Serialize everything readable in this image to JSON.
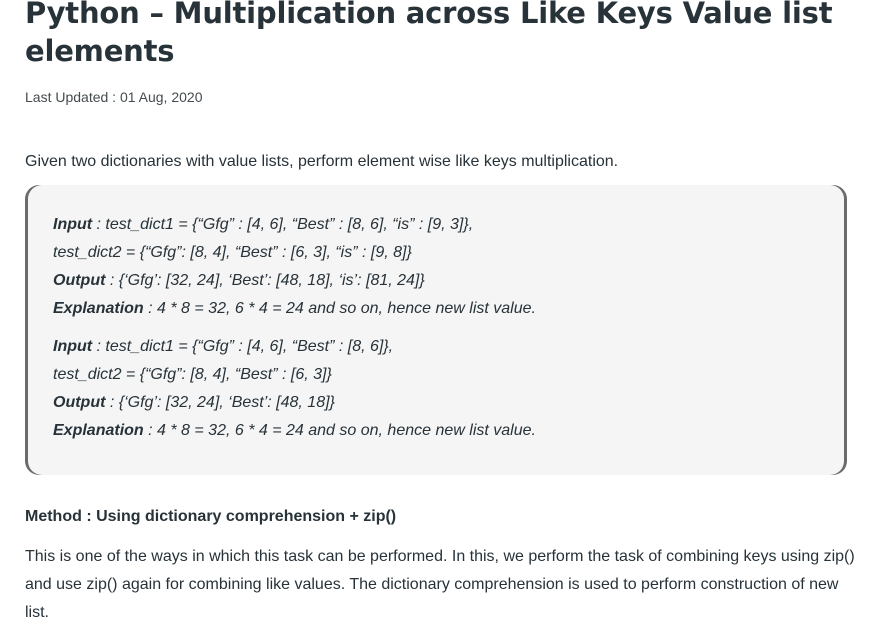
{
  "article": {
    "title": "Python – Multiplication across Like Keys Value list elements",
    "last_updated": "Last Updated : 01 Aug, 2020",
    "intro": "Given two dictionaries with value lists, perform element wise like keys multiplication.",
    "examples": [
      {
        "input_label": "Input",
        "input_value": " : test_dict1 = {“Gfg” : [4, 6], “Best” : [8, 6], “is” : [9, 3]},",
        "input_cont": "test_dict2 = {“Gfg”: [8, 4], “Best” : [6, 3], “is” : [9, 8]}",
        "output_label": "Output",
        "output_value": " : {‘Gfg’: [32, 24], ‘Best’: [48, 18], ‘is’: [81, 24]}",
        "explanation_label": "Explanation",
        "explanation_value": " : 4 * 8 = 32, 6 * 4 = 24 and so on, hence new list value."
      },
      {
        "input_label": "Input",
        "input_value": " : test_dict1 = {“Gfg” : [4, 6], “Best” : [8, 6]},",
        "input_cont": "test_dict2 = {“Gfg”: [8, 4], “Best” : [6, 3]}",
        "output_label": "Output",
        "output_value": " : {‘Gfg’: [32, 24], ‘Best’: [48, 18]}",
        "explanation_label": "Explanation",
        "explanation_value": " : 4 * 8 = 32, 6 * 4 = 24 and so on, hence new list value."
      }
    ],
    "method_heading": "Method : Using dictionary comprehension + zip()",
    "method_paragraph": "This is one of the ways in which this task can be performed. In this, we perform the task of combining keys using zip() and use zip() again for combining like values. The dictionary comprehension is used to perform construction of new list."
  },
  "colors": {
    "text": "#273239",
    "box_background": "#f5f5f5",
    "box_border": "#6b6b6b"
  }
}
